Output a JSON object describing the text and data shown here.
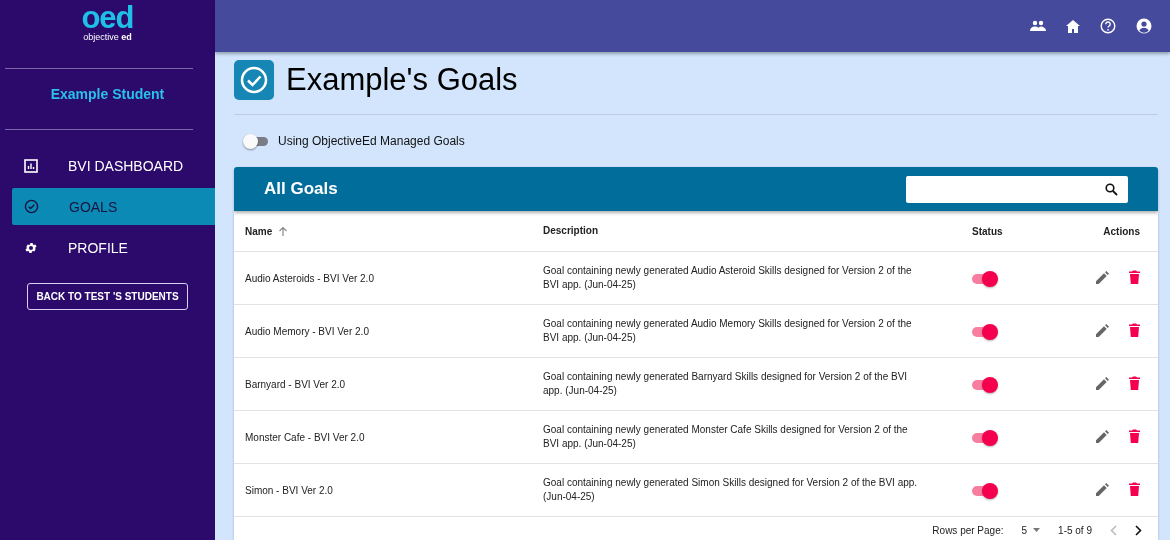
{
  "logo": {
    "mark": "oed",
    "tagline": "objective **ed**"
  },
  "student": {
    "name": "Example Student"
  },
  "nav": [
    {
      "label": "BVI DASHBOARD",
      "selected": false
    },
    {
      "label": "GOALS",
      "selected": true
    },
    {
      "label": "PROFILE",
      "selected": false
    }
  ],
  "back_button": "BACK TO TEST 'S STUDENTS",
  "page": {
    "title": "Example's Goals"
  },
  "managed_toggle": {
    "label": "Using ObjectiveEd Managed Goals",
    "on": false
  },
  "table": {
    "title": "All Goals",
    "columns": [
      "Name",
      "Description",
      "Status",
      "Actions"
    ],
    "rows": [
      {
        "name": "Audio Asteroids - BVI Ver 2.0",
        "description": "Goal containing newly generated Audio Asteroid Skills designed for Version 2 of the BVI app. (Jun-04-25)",
        "on": true
      },
      {
        "name": "Audio Memory - BVI Ver 2.0",
        "description": "Goal containing newly generated Audio Memory Skills designed for Version 2 of the BVI app. (Jun-04-25)",
        "on": true
      },
      {
        "name": "Barnyard - BVI Ver 2.0",
        "description": "Goal containing newly generated Barnyard Skills designed for Version 2 of the BVI app. (Jun-04-25)",
        "on": true
      },
      {
        "name": "Monster Cafe - BVI Ver 2.0",
        "description": "Goal containing newly generated Monster Cafe Skills designed for Version 2 of the BVI app. (Jun-04-25)",
        "on": true
      },
      {
        "name": "Simon - BVI Ver 2.0",
        "description": "Goal containing newly generated Simon Skills designed for Version 2 of the BVI app. (Jun-04-25)",
        "on": true
      }
    ]
  },
  "pagination": {
    "rows_label": "Rows per Page:",
    "rows_value": "5",
    "range": "1-5 of 9",
    "prev_disabled": true,
    "next_disabled": false
  }
}
